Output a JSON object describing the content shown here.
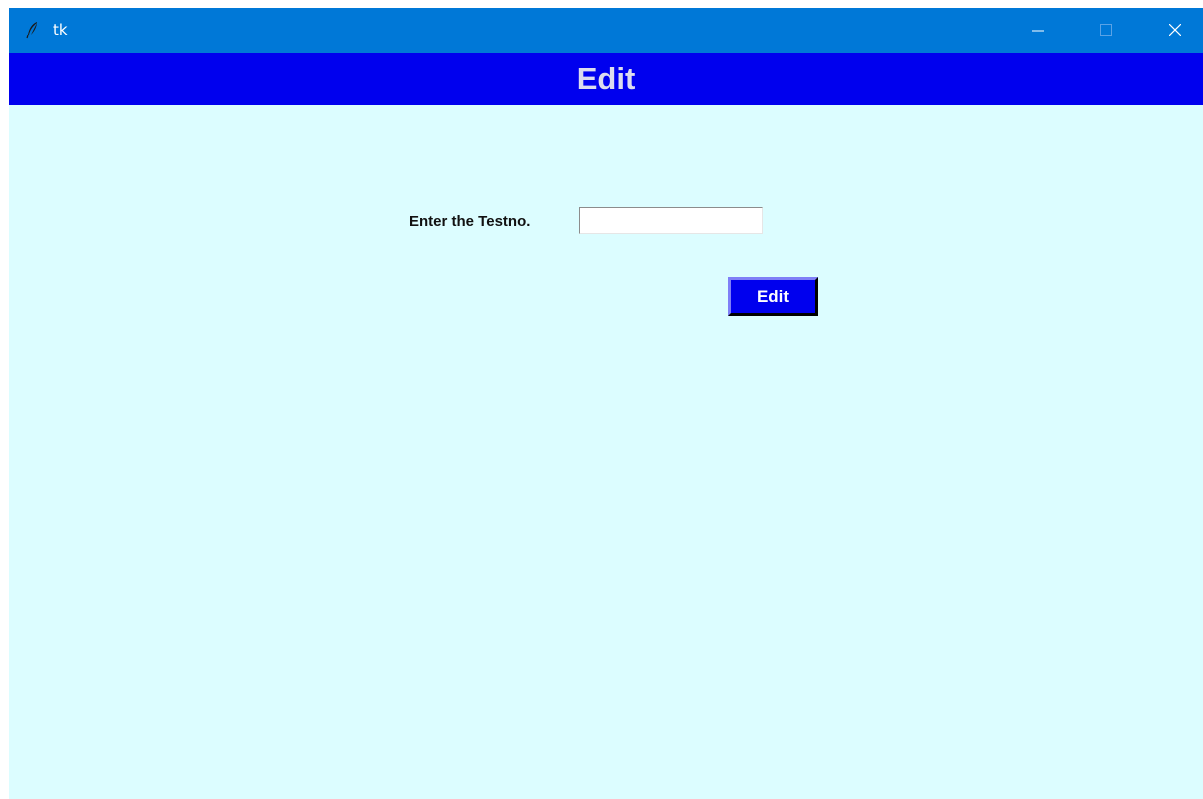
{
  "window": {
    "title": "tk",
    "icon": "feather-icon",
    "controls": {
      "minimize": "minimize-icon",
      "maximize": "maximize-icon",
      "close": "close-icon"
    }
  },
  "header": {
    "title": "Edit"
  },
  "form": {
    "testno_label": "Enter the Testno.",
    "testno_value": "",
    "edit_button_label": "Edit"
  },
  "colors": {
    "titlebar": "#0078d7",
    "header": "#0000ee",
    "background": "#dcfdff",
    "button": "#0000ee"
  }
}
